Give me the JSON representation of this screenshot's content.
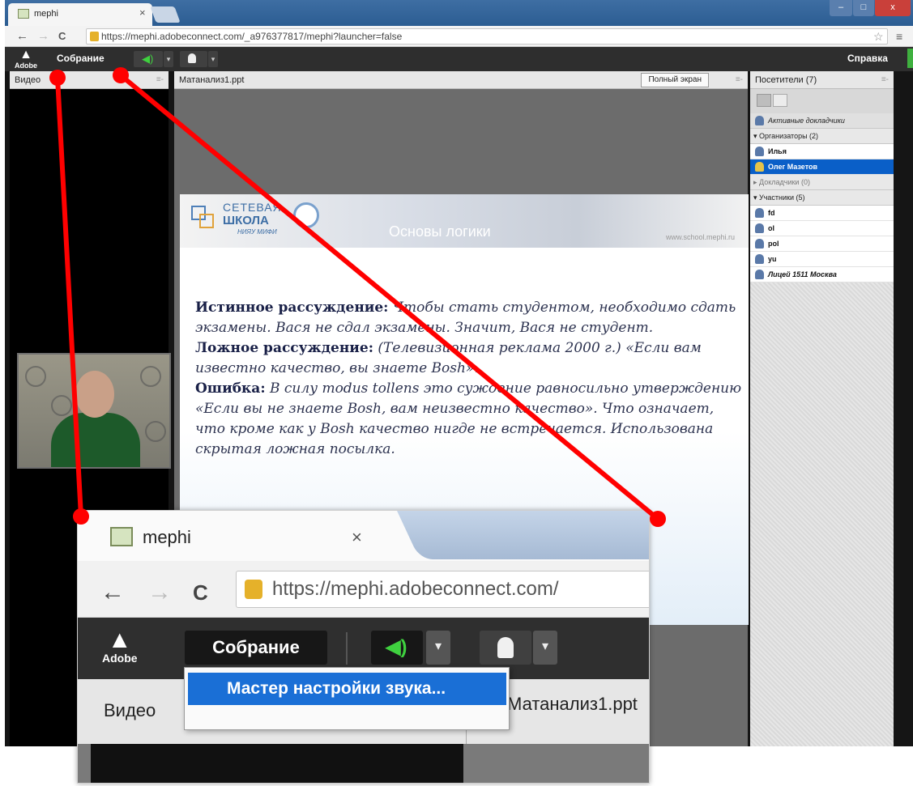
{
  "browser": {
    "tab_title": "mephi",
    "tab_close": "×",
    "url": "https://mephi.adobeconnect.com/_a976377817/mephi?launcher=false",
    "url_short": "https://mephi.adobeconnect.com/",
    "back": "←",
    "forward": "→",
    "reload": "C",
    "min": "–",
    "max": "□",
    "close": "x",
    "star": "☆",
    "menu": "≡"
  },
  "connect": {
    "logo_text": "Adobe",
    "meeting_menu": "Собрание",
    "help_menu": "Справка",
    "audio_arrow": "▾",
    "camera_arrow": "▾",
    "sound_wizard": "Мастер настройки звука..."
  },
  "pods": {
    "video_title": "Видео",
    "share_title": "Матанализ1.ppt",
    "fullscreen": "Полный экран",
    "attendees_title": "Посетители",
    "attendees_count": "(7)",
    "pod_menu": "≡-"
  },
  "attendees": {
    "active_speakers": "Активные докладчики",
    "hosts_group": "▾ Организаторы (2)",
    "hosts": [
      "Илья",
      "Олег Мазетов"
    ],
    "presenters_group": "▸ Докладчики (0)",
    "participants_group": "▾ Участники (5)",
    "participants": [
      "fd",
      "ol",
      "pol",
      "yu",
      "Лицей 1511 Москва"
    ]
  },
  "slide": {
    "banner_top": "СЕТЕВАЯ",
    "banner_school": "ШКОЛА",
    "banner_mephi": "НИЯУ МИФИ",
    "banner_heading": "Основы логики",
    "banner_url": "www.school.mephi.ru",
    "p1_bold": "Истинное рассуждение:",
    "p1_text": " Чтобы стать студентом, необходимо сдать экзамены. Вася не сдал экзамены. Значит, Вася не студент.",
    "p2_bold": "Ложное рассуждение:",
    "p2_text": " (Телевизионная реклама 2000 г.) «Если вам известно качество, вы знаете Bosh».",
    "p3_bold": "Ошибка:",
    "p3_text": " В силу modus tollens это суждение равносильно утверждению «Если вы не знаете Bosh, вам неизвестно качество». Что означает, что кроме как у Bosh качество нигде не встречается. Использована скрытая ложная посылка."
  },
  "colors": {
    "annotation_red": "#ff0000",
    "selection_blue": "#0a5fc8",
    "menu_highlight": "#1a6fd6"
  }
}
